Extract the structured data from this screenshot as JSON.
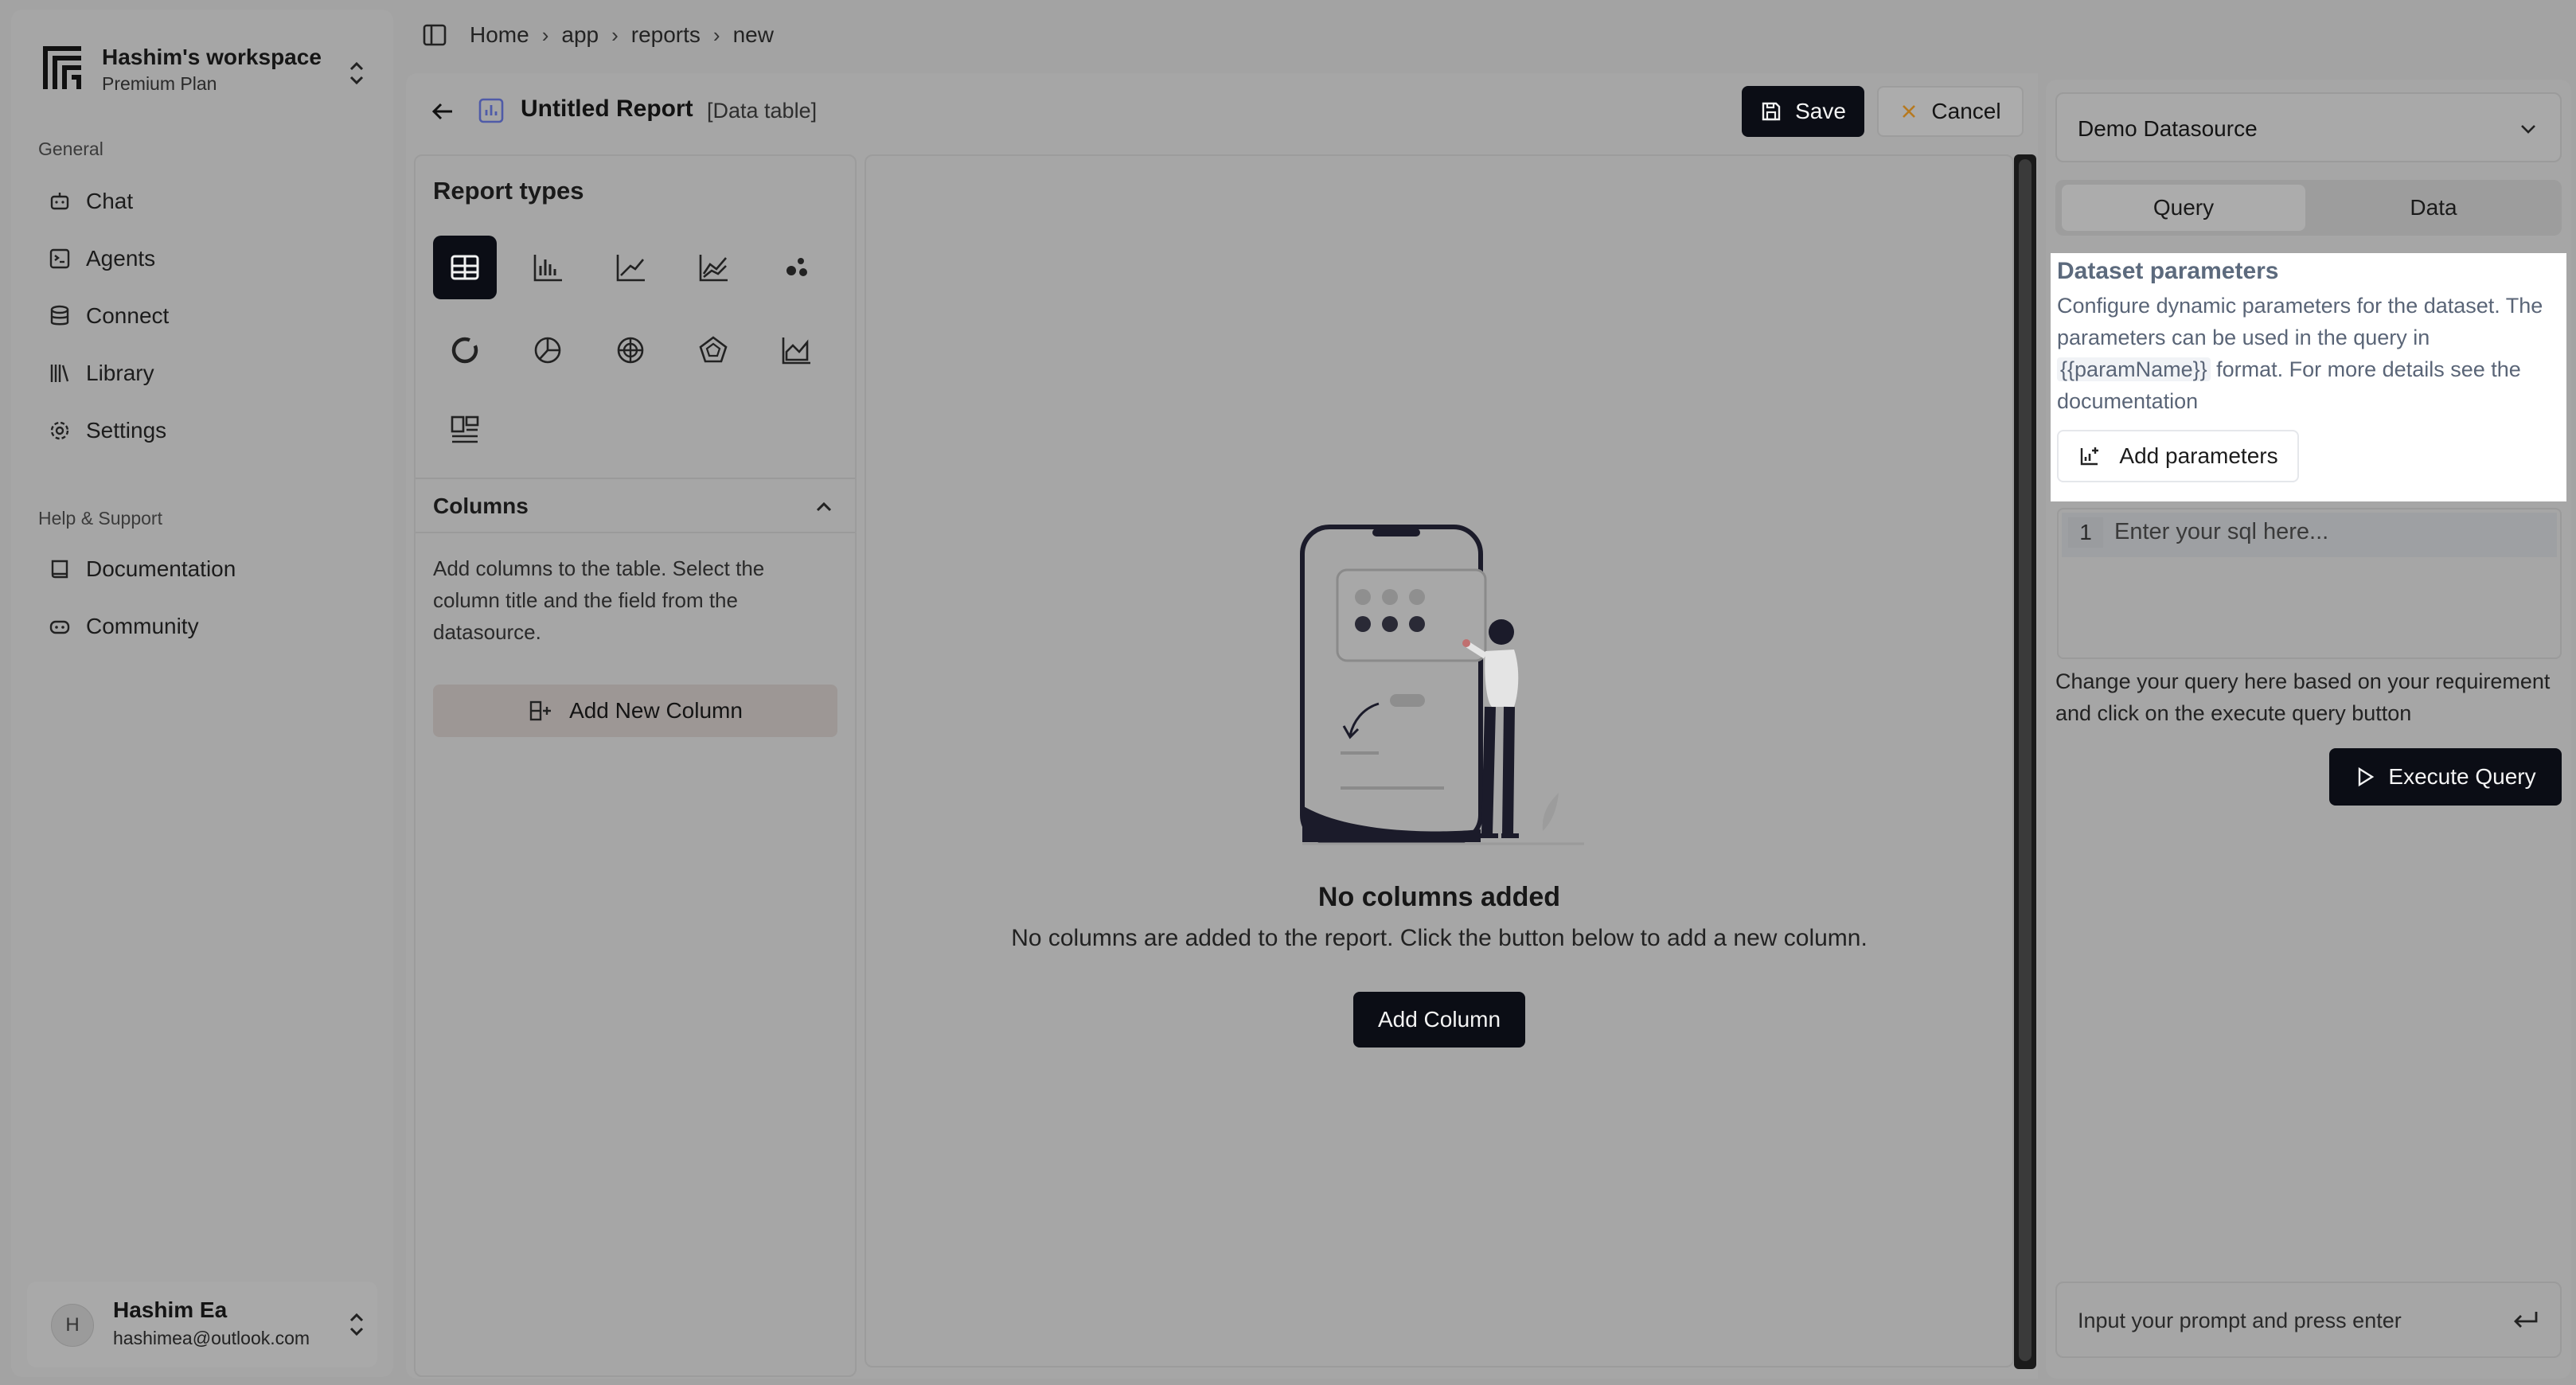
{
  "workspace": {
    "name": "Hashim's workspace",
    "plan": "Premium Plan"
  },
  "sidebar": {
    "general_label": "General",
    "general_items": [
      {
        "label": "Chat",
        "icon": "chat-bot-icon"
      },
      {
        "label": "Agents",
        "icon": "agents-icon"
      },
      {
        "label": "Connect",
        "icon": "database-icon"
      },
      {
        "label": "Library",
        "icon": "library-icon"
      },
      {
        "label": "Settings",
        "icon": "gear-icon"
      }
    ],
    "help_label": "Help & Support",
    "help_items": [
      {
        "label": "Documentation",
        "icon": "book-icon"
      },
      {
        "label": "Community",
        "icon": "community-icon"
      }
    ]
  },
  "user": {
    "initial": "H",
    "name": "Hashim Ea",
    "email": "hashimea@outlook.com"
  },
  "breadcrumb": [
    "Home",
    "app",
    "reports",
    "new"
  ],
  "report": {
    "title": "Untitled Report",
    "subtitle": "[Data table]",
    "save_label": "Save",
    "cancel_label": "Cancel"
  },
  "report_types": {
    "title": "Report types",
    "types": [
      "table-icon",
      "bar-chart-icon",
      "line-chart-icon",
      "multi-line-chart-icon",
      "scatter-chart-icon",
      "donut-chart-icon",
      "pie-chart-icon",
      "radar-chart-icon",
      "pentagon-chart-icon",
      "area-chart-icon",
      "layout-icon"
    ],
    "active_index": 0
  },
  "columns": {
    "title": "Columns",
    "description": "Add columns to the table. Select the column title and the field from the datasource.",
    "add_button": "Add New Column"
  },
  "empty_state": {
    "title": "No columns added",
    "description": "No columns are added to the report. Click the button below to add a new column.",
    "button": "Add Column"
  },
  "right_panel": {
    "datasource": "Demo Datasource",
    "tabs": [
      "Query",
      "Data"
    ],
    "active_tab": 0,
    "dataset_params": {
      "title": "Dataset parameters",
      "desc_before": "Configure dynamic parameters for the dataset. The parameters can be used in the query in ",
      "code": "{{paramName}}",
      "desc_after": " format. For more details see the documentation",
      "button": "Add parameters"
    },
    "sql": {
      "line_number": "1",
      "placeholder": "Enter your sql here..."
    },
    "help_text": "Change your query here based on your requirement and click on the execute query button",
    "execute_button": "Execute Query",
    "prompt_placeholder": "Input your prompt and press enter"
  }
}
